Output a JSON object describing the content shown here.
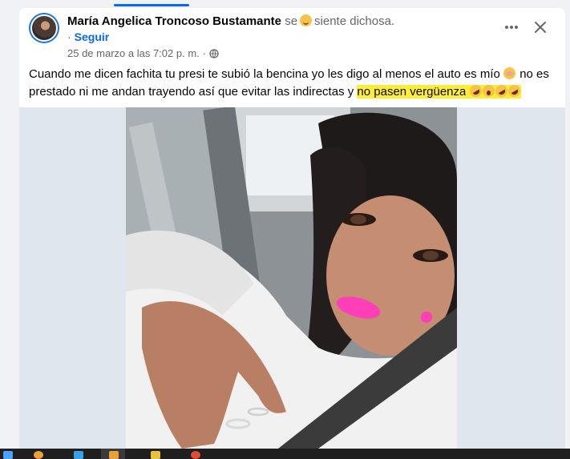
{
  "post": {
    "author": "María Angelica Troncoso Bustamante",
    "feeling_prefix": "se",
    "feeling_emoji": "smiling-face-icon",
    "feeling_text": "siente dichosa.",
    "follow_label": "Seguir",
    "follow_dot": "·",
    "timestamp": "25 de marzo a las 7:02 p. m.",
    "timestamp_sep": "·",
    "privacy_icon": "globe-icon",
    "more_icon": "more-horizontal-icon",
    "close_icon": "close-icon",
    "text_part1": "Cuando me dicen fachita tu presi te subió la bencina yo les digo al menos el auto es mío",
    "text_part2": " no es prestado ni me andan trayendo así que evitar las indirectas y",
    "text_highlight": "no pasen vergüenza",
    "emojis_trailing": [
      "rolling-on-floor-laughing-icon",
      "yawning-face-icon",
      "rolling-on-floor-laughing-icon",
      "rolling-on-floor-laughing-icon"
    ],
    "highlight_color": "#ffee33",
    "photo": "selfie-in-car"
  },
  "colors": {
    "accent": "#0866ff",
    "muted": "#65676b",
    "page_bg": "#f0f2f5"
  },
  "taskbar": {
    "icons": [
      "windows-start-icon",
      "chrome-icon",
      "app-icon",
      "active-app-icon",
      "folder-icon",
      "red-app-icon"
    ]
  }
}
